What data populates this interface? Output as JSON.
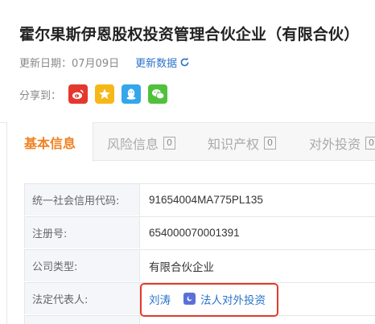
{
  "header": {
    "company_name": "霍尔果斯伊恩股权投资管理合伙企业（有限合伙）",
    "update_label": "更新日期：07月09日",
    "refresh_label": "更新数据"
  },
  "share": {
    "label": "分享到：",
    "buttons": [
      {
        "name": "weibo",
        "color": "#e5372e"
      },
      {
        "name": "qzone",
        "color": "#f6b818"
      },
      {
        "name": "qq",
        "color": "#35a6ea"
      },
      {
        "name": "wechat",
        "color": "#4fc13b"
      }
    ]
  },
  "tabs": [
    {
      "label": "基本信息",
      "active": true
    },
    {
      "label": "风险信息",
      "count": "0"
    },
    {
      "label": "知识产权",
      "count": "0"
    },
    {
      "label": "对外投资",
      "count": "0"
    }
  ],
  "info": {
    "rows": [
      {
        "label": "统一社会信用代码:",
        "value": "91654004MA775PL135"
      },
      {
        "label": "注册号:",
        "value": "654000070001391"
      },
      {
        "label": "公司类型:",
        "value": "有限合伙企业"
      },
      {
        "label": "法定代表人:",
        "value": "刘涛",
        "link": "法人对外投资"
      }
    ]
  },
  "colors": {
    "accent": "#f08121",
    "link": "#2a74c9",
    "highlight": "#e33a2a"
  }
}
